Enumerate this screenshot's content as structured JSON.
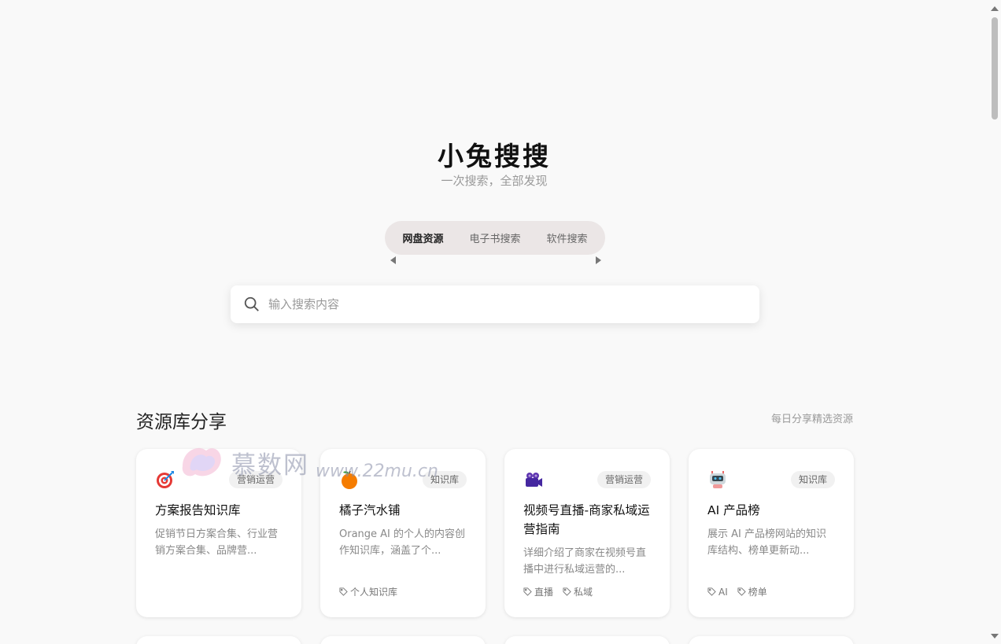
{
  "header": {
    "title": "小兔搜搜",
    "subtitle": "一次搜索，全部发现"
  },
  "tabs": [
    {
      "label": "网盘资源",
      "active": true
    },
    {
      "label": "电子书搜索",
      "active": false
    },
    {
      "label": "软件搜索",
      "active": false
    }
  ],
  "search": {
    "placeholder": "输入搜索内容",
    "value": ""
  },
  "section": {
    "title": "资源库分享",
    "note": "每日分享精选资源"
  },
  "cards": [
    {
      "icon": "target-icon",
      "badge": "营销运营",
      "title": "方案报告知识库",
      "desc": "促销节日方案合集、行业营销方案合集、品牌营...",
      "tags": []
    },
    {
      "icon": "orange-icon",
      "badge": "知识库",
      "title": "橘子汽水铺",
      "desc": "Orange AI 的个人的内容创作知识库，涵盖了个...",
      "tags": [
        "个人知识库"
      ]
    },
    {
      "icon": "video-camera-icon",
      "badge": "营销运营",
      "title": "视频号直播-商家私域运营指南",
      "desc": "详细介绍了商家在视频号直播中进行私域运营的...",
      "tags": [
        "直播",
        "私域"
      ]
    },
    {
      "icon": "robot-icon",
      "badge": "知识库",
      "title": "AI 产品榜",
      "desc": "展示 AI 产品榜网站的知识库结构、榜单更新动...",
      "tags": [
        "AI",
        "榜单"
      ]
    }
  ],
  "watermark": {
    "text": "慕数网",
    "url": "www.22mu.cn"
  },
  "colors": {
    "background": "#f9f9f9",
    "tab_bg": "#ebe6e6",
    "card_bg": "#ffffff"
  }
}
